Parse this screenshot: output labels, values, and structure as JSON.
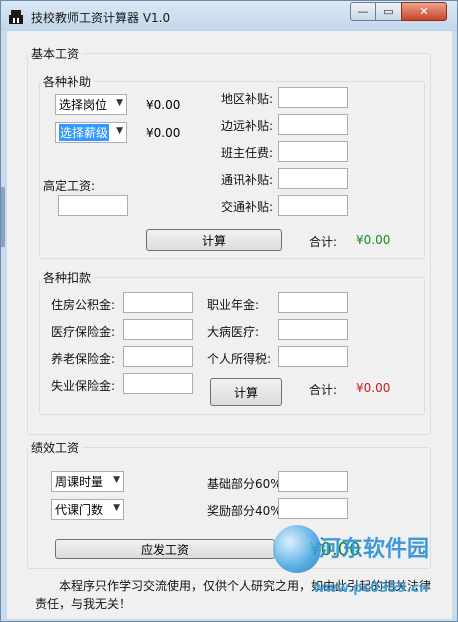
{
  "window": {
    "title": "技校教师工资计算器 V1.0",
    "min": "—",
    "max": "▭",
    "close": "✕"
  },
  "basic": {
    "legend": "基本工资",
    "allowance": {
      "legend": "各种补助",
      "post_combo": "选择岗位",
      "grade_combo": "选择薪级",
      "post_amount": "¥0.00",
      "grade_amount": "¥0.00",
      "fixed_salary_label": "高定工资:",
      "fields": [
        {
          "label": "地区补贴:"
        },
        {
          "label": "边远补贴:"
        },
        {
          "label": "班主任费:"
        },
        {
          "label": "通讯补贴:"
        },
        {
          "label": "交通补贴:"
        }
      ],
      "calc_button": "计算",
      "total_label": "合计:",
      "total_value": "¥0.00"
    },
    "deduction": {
      "legend": "各种扣款",
      "left_fields": [
        {
          "label": "住房公积金:"
        },
        {
          "label": "医疗保险金:"
        },
        {
          "label": "养老保险金:"
        },
        {
          "label": "失业保险金:"
        }
      ],
      "right_fields": [
        {
          "label": "职业年金:"
        },
        {
          "label": "大病医疗:"
        },
        {
          "label": "个人所得税:"
        }
      ],
      "calc_button": "计算",
      "total_label": "合计:",
      "total_value": "¥0.00"
    }
  },
  "performance": {
    "legend": "绩效工资",
    "weekly_hours_combo": "周课时量",
    "substitute_combo": "代课门数",
    "base_label": "基础部分60%",
    "bonus_label": "奖励部分40%",
    "pay_button": "应发工资",
    "pay_value": "¥0.00"
  },
  "note": {
    "line1": "本程序只作学习交流使用，仅供个人研究之用，如由此引起的相关法律",
    "line2": "责任，与我无关！"
  },
  "watermark": {
    "name": "河东软件园",
    "url": "www.pc0359.cn"
  },
  "colors": {
    "green": "#1a8a1a",
    "red": "#cc1a1a",
    "selection": "#3399ff"
  }
}
